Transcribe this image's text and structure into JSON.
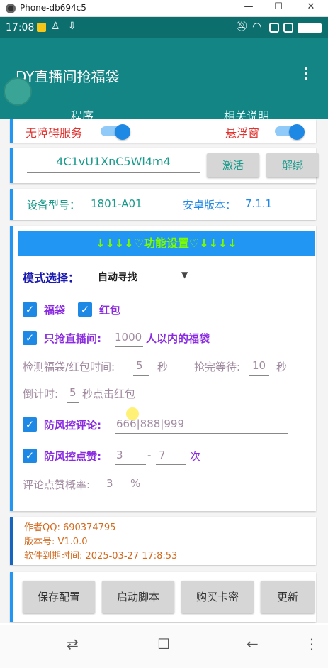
{
  "window": {
    "title": "Phone-db694c5",
    "minimize": "—",
    "maximize": "☐",
    "close": "✕"
  },
  "status": {
    "time": "17:08"
  },
  "app": {
    "title": "DY直播间抢福袋",
    "tabs": [
      "程序",
      "相关说明"
    ]
  },
  "services": {
    "accessibility": "无障碍服务",
    "floating": "悬浮窗"
  },
  "activation": {
    "code": "4C1vU1XnC5Wl4m4",
    "activate": "激活",
    "unbind": "解绑"
  },
  "device": {
    "model_label": "设备型号：",
    "model": "1801-A01",
    "android_label": "安卓版本：",
    "android": "7.1.1"
  },
  "settings": {
    "header": "↓↓↓↓♡功能设置♡↓↓↓↓",
    "mode_label": "模式选择：",
    "mode_value": "自动寻找",
    "fudai": "福袋",
    "hongbao": "红包",
    "only_grab_label": "只抢直播间:",
    "only_grab_value": "1000",
    "only_grab_suffix": "人以内的福袋",
    "detect_label": "检测福袋/红包时间:",
    "detect_value": "5",
    "detect_unit": "秒",
    "wait_label": "抢完等待:",
    "wait_value": "10",
    "wait_unit": "秒",
    "countdown_label": "倒计时:",
    "countdown_value": "5",
    "countdown_suffix": "秒点击红包",
    "anti_comment_label": "防风控评论:",
    "anti_comment_value": "666|888|999",
    "anti_like_label": "防风控点赞:",
    "like_min": "3",
    "like_dash": "-",
    "like_max": "7",
    "like_unit": "次",
    "rate_label": "评论点赞概率:",
    "rate_value": "3",
    "rate_unit": "%"
  },
  "info": {
    "author": "作者QQ: 690374795",
    "version": "版本号: V1.0.0",
    "expiry": "软件到期时间:   2025-03-27 17:8:53"
  },
  "actions": {
    "save": "保存配置",
    "start": "启动脚本",
    "buy": "购买卡密",
    "update": "更新"
  },
  "nav": {
    "menu": "⇄",
    "home": "☐",
    "back": "←",
    "more": "⋮"
  }
}
